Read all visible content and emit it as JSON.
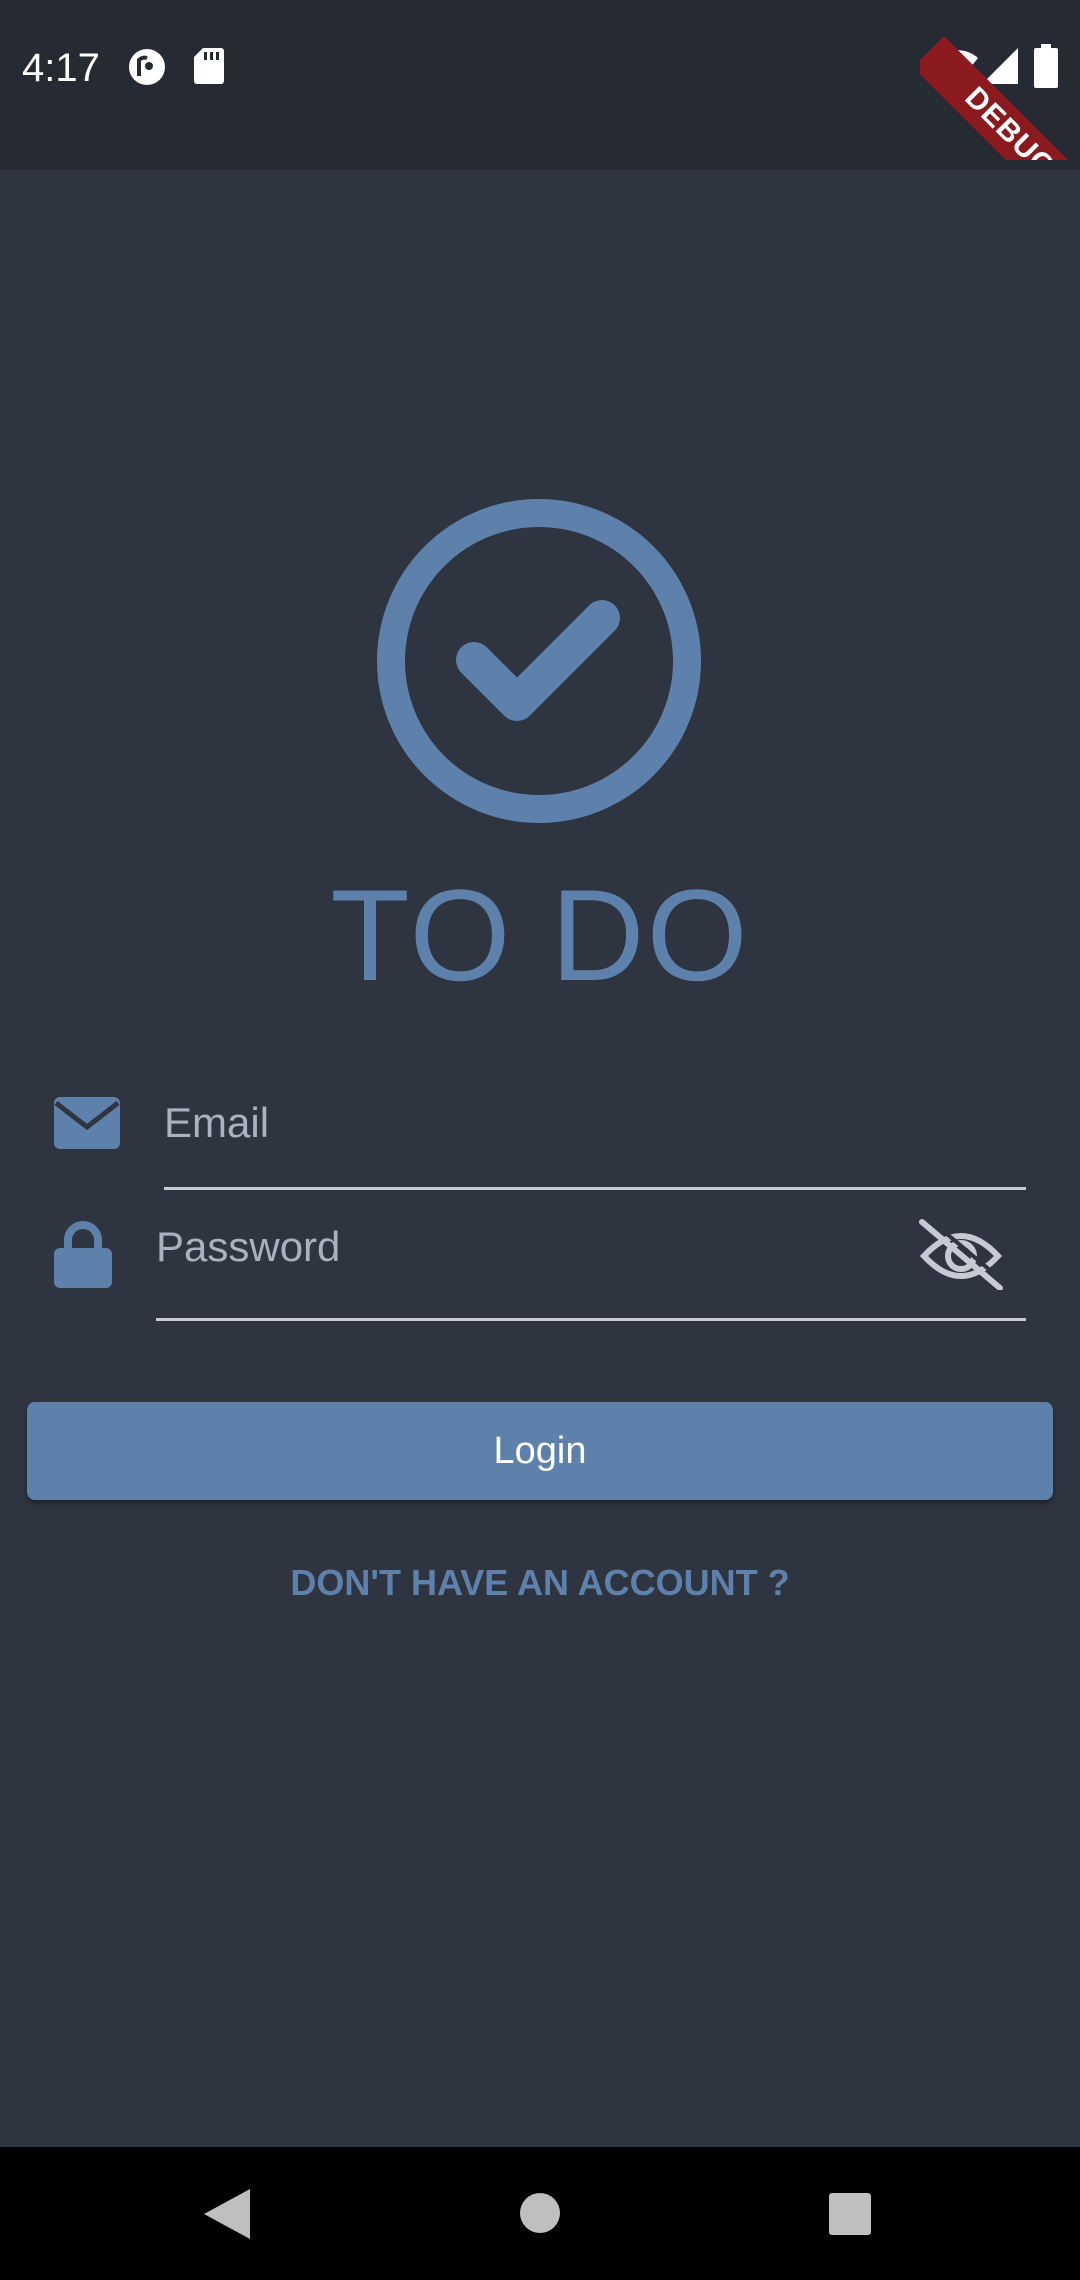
{
  "status_bar": {
    "time": "4:17",
    "icons": [
      "pocket-casts-icon",
      "sd-card-icon",
      "wifi-icon",
      "cellular-signal-icon",
      "battery-icon"
    ]
  },
  "debug_banner": {
    "label": "DEBUG"
  },
  "app": {
    "logo_icon": "check-circle-icon",
    "title": "TO DO"
  },
  "form": {
    "email": {
      "icon": "envelope-icon",
      "placeholder": "Email",
      "value": ""
    },
    "password": {
      "icon": "lock-icon",
      "placeholder": "Password",
      "value": "",
      "visibility_icon": "eye-off-icon"
    },
    "login_label": "Login",
    "signup_label": "DON'T HAVE AN ACCOUNT ?"
  },
  "nav_bar": {
    "buttons": [
      "back-icon",
      "home-icon",
      "recents-icon"
    ]
  },
  "colors": {
    "background": "#2e3440",
    "status_bar": "#252a33",
    "accent": "#5e81ac",
    "debug_ribbon": "#8b1a1f",
    "nav_bar": "#000000"
  }
}
